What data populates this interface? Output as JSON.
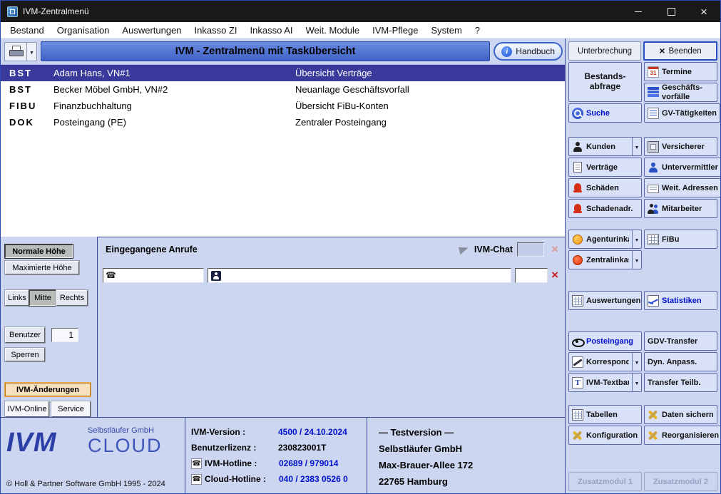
{
  "window": {
    "title": "IVM-Zentralmenü"
  },
  "menubar": {
    "items": [
      "Bestand",
      "Organisation",
      "Auswertungen",
      "Inkasso ZI",
      "Inkasso AI",
      "Weit. Module",
      "IVM-Pflege",
      "System",
      "?"
    ]
  },
  "toolbar": {
    "banner_title": "IVM - Zentralmenü mit Taskübersicht",
    "handbuch_label": "Handbuch",
    "unterbrechung_label": "Unterbrechung",
    "beenden_label": "Beenden"
  },
  "tasks": {
    "rows": [
      {
        "type": "BST",
        "name": "Adam Hans, VN#1",
        "task": "Übersicht Verträge"
      },
      {
        "type": "BST",
        "name": "Becker Möbel GmbH, VN#2",
        "task": "Neuanlage Geschäftsvorfall"
      },
      {
        "type": "FIBU",
        "name": "Finanzbuchhaltung",
        "task": "Übersicht FiBu-Konten"
      },
      {
        "type": "DOK",
        "name": "Posteingang (PE)",
        "task": "Zentraler Posteingang"
      }
    ]
  },
  "left_panel": {
    "normale_hoehe": "Normale Höhe",
    "maximierte_hoehe": "Maximierte Höhe",
    "links": "Links",
    "mitte": "Mitte",
    "rechts": "Rechts",
    "benutzer": "Benutzer",
    "benutzer_value": "1",
    "sperren": "Sperren",
    "ivm_aenderungen": "IVM-Änderungen",
    "ivm_online": "IVM-Online",
    "service": "Service"
  },
  "calls_panel": {
    "title": "Eingegangene Anrufe",
    "chat_label": "IVM-Chat",
    "phone_field_value": "",
    "caller_field_value": "",
    "extra_field_value": ""
  },
  "sidebar": {
    "bestandsabfrage": "Bestands-abfrage",
    "termine": "Termine",
    "geschaeftsvorfaelle": "Geschäfts-vorfälle",
    "suche": "Suche",
    "gv_taetigkeiten": "GV-Tätigkeiten",
    "kunden": "Kunden",
    "versicherer": "Versicherer",
    "vertraege": "Verträge",
    "untervermittler": "Untervermittler",
    "schaeden": "Schäden",
    "weit_adressen": "Weit. Adressen",
    "schadenadr": "Schadenadr.",
    "mitarbeiter": "Mitarbeiter",
    "agenturinkasso": "Agenturinkasso",
    "fibu": "FiBu",
    "zentralinkasso": "Zentralinkasso",
    "auswertungen": "Auswertungen",
    "statistiken": "Statistiken",
    "posteingang": "Posteingang",
    "gdv_transfer": "GDV-Transfer",
    "korrespondenz": "Korrespondenz",
    "dyn_anpass": "Dyn. Anpass.",
    "ivm_textbaust": "IVM-Textbaust.",
    "transfer_teilb": "Transfer Teilb.",
    "tabellen": "Tabellen",
    "daten_sichern": "Daten sichern",
    "konfiguration": "Konfiguration",
    "reorganisieren": "Reorganisieren",
    "zusatzmodul1": "Zusatzmodul 1",
    "zusatzmodul2": "Zusatzmodul 2"
  },
  "footer": {
    "logo": "IVM",
    "logo_firm": "Selbstläufer GmbH",
    "cloud": "CLOUD",
    "copyright": "© Holl & Partner Software GmbH  1995 - 2024",
    "version_label": "IVM-Version :",
    "version_value": "4500 / 24.10.2024",
    "license_label": "Benutzerlizenz :",
    "license_value": "230823001T",
    "hotline_label": "IVM-Hotline :",
    "hotline_value": "02689 / 979014",
    "cloud_hotline_label": "Cloud-Hotline :",
    "cloud_hotline_value": "040 / 2383 0526 0",
    "testversion": "— Testversion —",
    "company": "Selbstläufer GmbH",
    "street": "Max-Brauer-Allee 172",
    "city": "22765 Hamburg"
  },
  "colors": {
    "background": "#cdd6f0",
    "banner_blue": "#4468cc",
    "selected_row": "#3a3a9c",
    "accent_text_blue": "#0012cc",
    "alert_red": "#d43018",
    "highlight_orange": "#f7e0bd"
  },
  "icons": {
    "printer-icon": "css printer shape",
    "info-icon": "blue circle with white i",
    "calendar-icon": "calendar showing 31",
    "books-icon": "stacked blue books",
    "search-icon": "blue magnifier badge",
    "list-icon": "list sheet",
    "person-icon": "person silhouette",
    "persons-icon": "two persons",
    "building-icon": "safe/building",
    "document-icon": "document with lines",
    "bell-icon": "red bell",
    "card-icon": "address card",
    "coin-orange-icon": "orange coin",
    "coin-red-icon": "red coin",
    "grid-icon": "table grid",
    "stat-icon": "line chart",
    "eye-icon": "eye",
    "pen-icon": "pen over paper",
    "text-icon": "letter T sheet",
    "tools-icon": "crossed tools",
    "plane-icon": "paper plane",
    "phone-icon": "telephone ☎",
    "chevron-down-icon": "▼",
    "close-x-icon": "×"
  }
}
